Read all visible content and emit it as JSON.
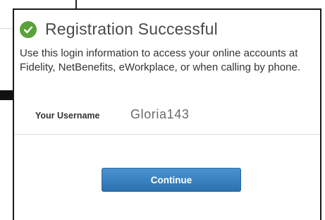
{
  "dialog": {
    "title": "Registration Successful",
    "description": "Use this login information to access your online accounts at Fidelity, NetBenefits, eWorkplace, or when calling by phone.",
    "username_label": "Your Username",
    "username_value": "Gloria143",
    "continue_label": "Continue"
  },
  "icons": {
    "success": "check-circle-icon"
  },
  "colors": {
    "success_green": "#5aa13b",
    "button_blue": "#2c71b0",
    "title_gray": "#4a4a4a"
  }
}
